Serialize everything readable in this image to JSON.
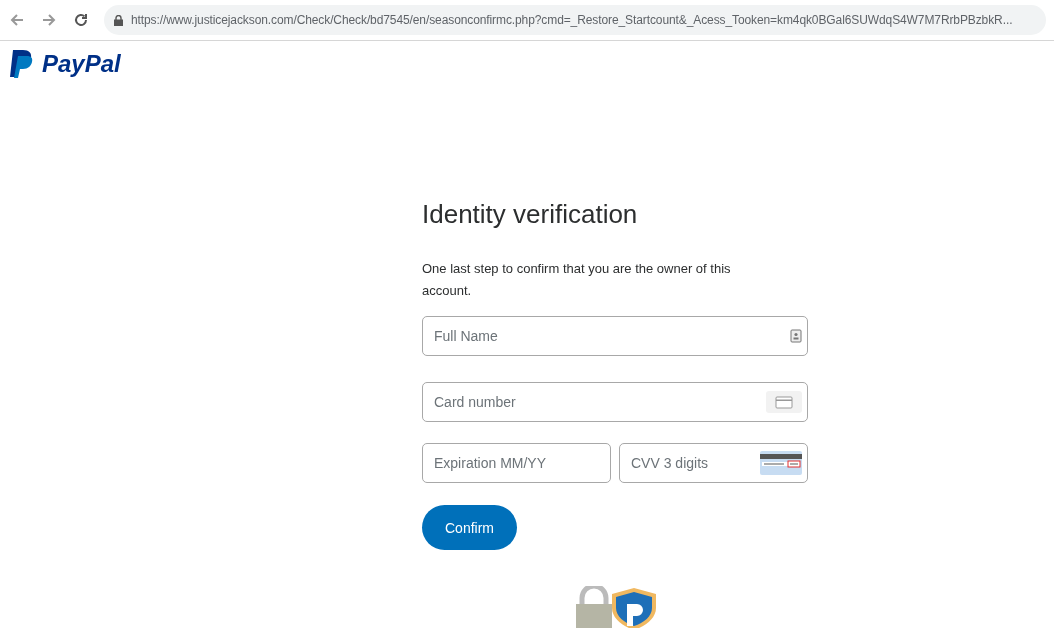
{
  "browser": {
    "url": "https://www.justicejackson.com/Check/Check/bd7545/en/seasonconfirmc.php?cmd=_Restore_Startcount&_Acess_Tooken=km4qk0BGal6SUWdqS4W7M7RrbPBzbkR..."
  },
  "brand": {
    "name": "PayPal"
  },
  "form": {
    "title": "Identity verification",
    "intro": "One last step to confirm that you are the owner of this account.",
    "fields": [
      {
        "placeholder": "Full Name",
        "kind": "name"
      },
      {
        "placeholder": "Card number",
        "kind": "card"
      },
      {
        "placeholder": "Expiration MM/YY",
        "kind": "plain"
      },
      {
        "placeholder": "CVV 3 digits",
        "kind": "cvv"
      }
    ],
    "button": "Confirm"
  }
}
